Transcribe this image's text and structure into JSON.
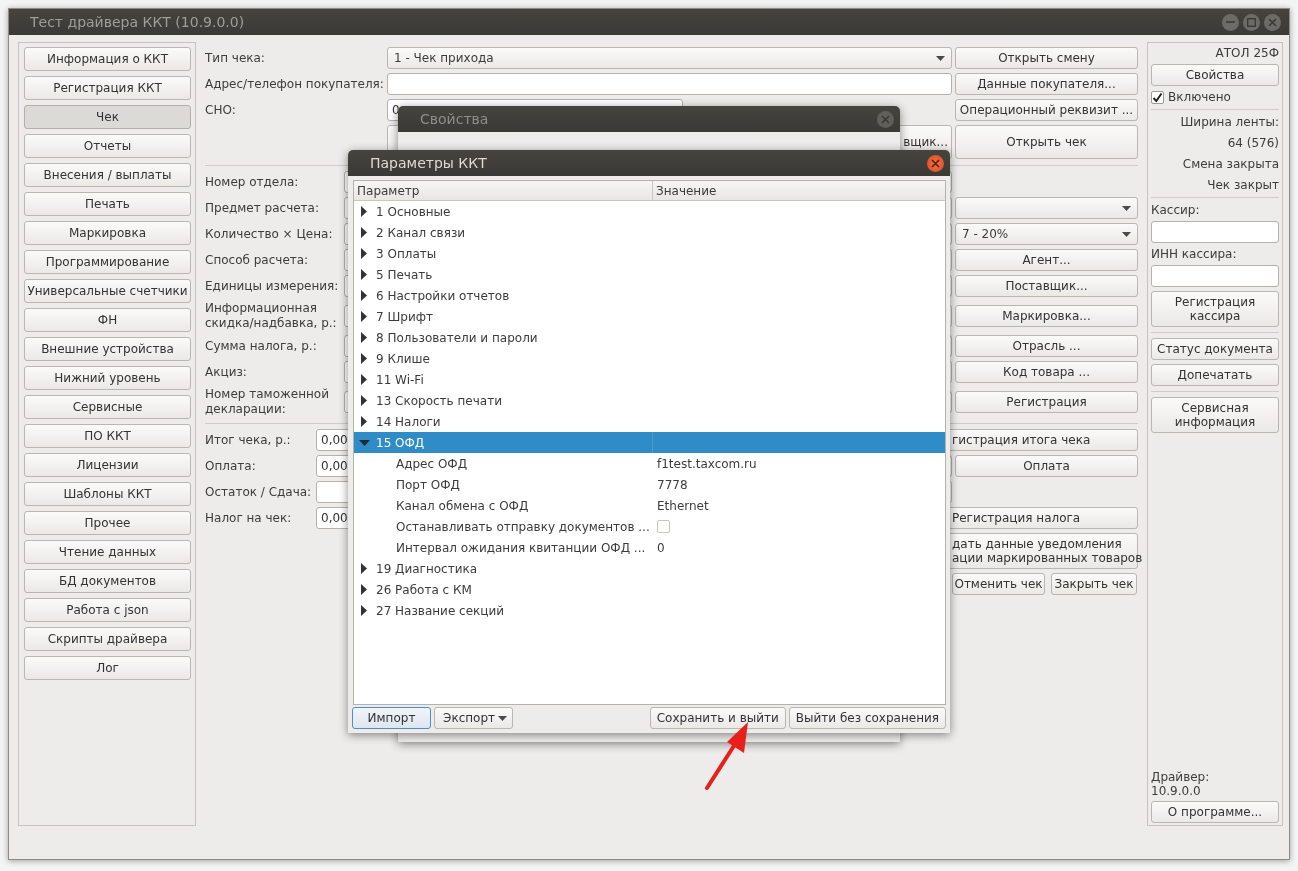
{
  "window": {
    "title": "Тест драйвера ККТ (10.9.0.0)"
  },
  "sidebar": {
    "items": [
      {
        "label": "Информация о ККТ",
        "selected": false
      },
      {
        "label": "Регистрация ККТ",
        "selected": false
      },
      {
        "label": "Чек",
        "selected": true
      },
      {
        "label": "Отчеты",
        "selected": false
      },
      {
        "label": "Внесения / выплаты",
        "selected": false
      },
      {
        "label": "Печать",
        "selected": false
      },
      {
        "label": "Маркировка",
        "selected": false
      },
      {
        "label": "Программирование",
        "selected": false
      },
      {
        "label": "Универсальные счетчики",
        "selected": false
      },
      {
        "label": "ФН",
        "selected": false
      },
      {
        "label": "Внешние устройства",
        "selected": false
      },
      {
        "label": "Нижний уровень",
        "selected": false
      },
      {
        "label": "Сервисные",
        "selected": false
      },
      {
        "label": "ПО ККТ",
        "selected": false
      },
      {
        "label": "Лицензии",
        "selected": false
      },
      {
        "label": "Шаблоны ККТ",
        "selected": false
      },
      {
        "label": "Прочее",
        "selected": false
      },
      {
        "label": "Чтение данных",
        "selected": false
      },
      {
        "label": "БД документов",
        "selected": false
      },
      {
        "label": "Работа с json",
        "selected": false
      },
      {
        "label": "Скрипты драйвера",
        "selected": false
      },
      {
        "label": "Лог",
        "selected": false
      }
    ]
  },
  "receipt_form": {
    "header_rows": [
      {
        "label": "Тип чека:",
        "field": {
          "kind": "combo",
          "value": "1 - Чек прихода"
        },
        "action": {
          "kind": "button",
          "label": "Открыть смену"
        }
      },
      {
        "label": "Адрес/телефон покупателя:",
        "field": {
          "kind": "input"
        },
        "action": {
          "kind": "button",
          "label": "Данные покупателя..."
        }
      },
      {
        "label": "СНО:",
        "field": {
          "kind": "short_input",
          "value": "0"
        },
        "action": {
          "kind": "button",
          "label": "Операционный реквизит ..."
        }
      },
      {
        "field": {
          "kind": "button",
          "label": "вщик..."
        },
        "action": {
          "kind": "button",
          "label": "Открыть чек"
        }
      }
    ],
    "item_rows": [
      {
        "label": "Номер отдела:"
      },
      {
        "label": "Предмет расчета:",
        "action": {
          "kind": "combo"
        }
      },
      {
        "label": "Количество × Цена:",
        "action": {
          "kind": "combo",
          "value": "7 - 20%"
        }
      },
      {
        "label": "Способ расчета:",
        "action": {
          "kind": "button",
          "label": "Агент..."
        }
      },
      {
        "label": "Единицы измерения:",
        "action": {
          "kind": "button",
          "label": "Поставщик..."
        }
      },
      {
        "label": "Информационная скидка/надбавка, р.:",
        "action": {
          "kind": "button",
          "label": "Маркировка..."
        }
      },
      {
        "label": "Сумма налога, р.:",
        "action": {
          "kind": "button",
          "label": "Отрасль ..."
        }
      },
      {
        "label": "Акциз:",
        "action": {
          "kind": "button",
          "label": "Код товара ..."
        }
      },
      {
        "label": "Номер таможенной декларации:",
        "action": {
          "kind": "button",
          "label": "Регистрация"
        }
      }
    ],
    "total_rows": [
      {
        "label": "Итог чека, р.:",
        "value": "0,00",
        "action": {
          "kind": "clipped_button",
          "lines": [
            "гистрация итога чека"
          ]
        }
      },
      {
        "label": "Оплата:",
        "value": "0,00",
        "action": {
          "kind": "button",
          "label": "Оплата"
        }
      },
      {
        "label": "Остаток / Сдача:"
      },
      {
        "label": "Налог на чек:",
        "value": "0,00",
        "action": {
          "kind": "clipped_button",
          "lines": [
            "Регистрация налога"
          ]
        }
      },
      {
        "action": {
          "kind": "clipped_button",
          "lines": [
            "дать данные уведомления",
            "ации маркированных товаров"
          ]
        }
      },
      {
        "action": {
          "kind": "button_pair",
          "labels": [
            "Отменить чек",
            "Закрыть чек"
          ]
        }
      }
    ]
  },
  "device_panel": {
    "sections": [
      [
        {
          "kind": "status",
          "text": "АТОЛ 25Ф"
        },
        {
          "kind": "button",
          "text": "Свойства"
        },
        {
          "kind": "checkbox",
          "text": "Включено",
          "checked": true
        }
      ],
      [
        {
          "kind": "status",
          "text": "Ширина ленты:"
        },
        {
          "kind": "status",
          "text": "64 (576)"
        },
        {
          "kind": "status",
          "text": "Смена закрыта"
        },
        {
          "kind": "status",
          "text": "Чек закрыт"
        }
      ],
      [
        {
          "kind": "label",
          "text": "Кассир:"
        },
        {
          "kind": "field"
        },
        {
          "kind": "label",
          "text": "ИНН кассира:"
        },
        {
          "kind": "field"
        },
        {
          "kind": "button",
          "text": "Регистрация кассира"
        }
      ],
      [
        {
          "kind": "button",
          "text": "Статус документа"
        },
        {
          "kind": "button",
          "text": "Допечатать"
        }
      ],
      [
        {
          "kind": "button",
          "text": "Сервисная информация"
        }
      ]
    ],
    "footer": [
      {
        "kind": "label",
        "text": "Драйвер:"
      },
      {
        "kind": "label",
        "text": "10.9.0.0"
      },
      {
        "kind": "button",
        "text": "О программе..."
      }
    ]
  },
  "properties_dialog": {
    "title": "Свойства"
  },
  "params_dialog": {
    "title": "Параметры ККТ",
    "columns": [
      "Параметр",
      "Значение"
    ],
    "rows": [
      {
        "label": "1 Основные",
        "expanded": false,
        "selected": false
      },
      {
        "label": "2 Канал связи",
        "expanded": false,
        "selected": false
      },
      {
        "label": "3 Оплаты",
        "expanded": false,
        "selected": false
      },
      {
        "label": "5 Печать",
        "expanded": false,
        "selected": false
      },
      {
        "label": "6 Настройки отчетов",
        "expanded": false,
        "selected": false
      },
      {
        "label": "7 Шрифт",
        "expanded": false,
        "selected": false
      },
      {
        "label": "8 Пользователи и пароли",
        "expanded": false,
        "selected": false
      },
      {
        "label": "9 Клише",
        "expanded": false,
        "selected": false
      },
      {
        "label": "11 Wi-Fi",
        "expanded": false,
        "selected": false
      },
      {
        "label": "13 Скорость печати",
        "expanded": false,
        "selected": false
      },
      {
        "label": "14 Налоги",
        "expanded": false,
        "selected": false
      },
      {
        "label": "15 ОФД",
        "expanded": true,
        "selected": true,
        "children": [
          {
            "label": "Адрес ОФД",
            "kind": "text",
            "value": "f1test.taxcom.ru",
            "selected": false
          },
          {
            "label": "Порт ОФД",
            "kind": "text",
            "value": "7778",
            "selected": false
          },
          {
            "label": "Канал обмена с ОФД",
            "kind": "text",
            "value": "Ethernet",
            "selected": false
          },
          {
            "label": "Останавливать отправку документов ...",
            "kind": "checkbox",
            "checked": false,
            "selected": false
          },
          {
            "label": "Интервал ожидания квитанции ОФД ...",
            "kind": "text",
            "value": "0",
            "selected": false
          }
        ]
      },
      {
        "label": "19 Диагностика",
        "expanded": false,
        "selected": false
      },
      {
        "label": "26 Работа с КМ",
        "expanded": false,
        "selected": false
      },
      {
        "label": "27 Название секций",
        "expanded": false,
        "selected": false
      }
    ],
    "buttons": [
      {
        "label": "Импорт",
        "kind": "button",
        "focused": true
      },
      {
        "label": "Экспорт",
        "kind": "menu",
        "focused": false
      },
      {
        "label": "Сохранить и выйти",
        "kind": "button",
        "focused": false
      },
      {
        "label": "Выйти без сохранения",
        "kind": "button",
        "focused": false
      }
    ]
  }
}
